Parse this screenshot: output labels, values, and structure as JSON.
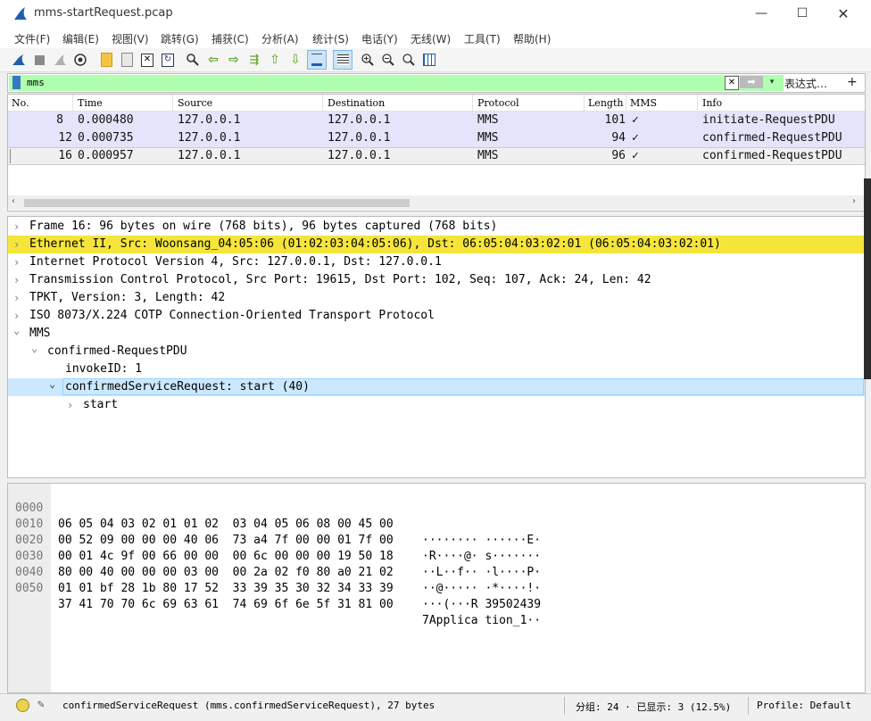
{
  "window": {
    "title": "mms-startRequest.pcap"
  },
  "menu": [
    "文件(F)",
    "编辑(E)",
    "视图(V)",
    "跳转(G)",
    "捕获(C)",
    "分析(A)",
    "统计(S)",
    "电话(Y)",
    "无线(W)",
    "工具(T)",
    "帮助(H)"
  ],
  "filter": {
    "value": "mms",
    "expression_label": "表达式…",
    "plus_label": "+"
  },
  "packet_list": {
    "columns": [
      "No.",
      "Time",
      "Source",
      "Destination",
      "Protocol",
      "Length",
      "MMS",
      "Info"
    ],
    "rows": [
      {
        "no": "8",
        "time": "0.000480",
        "src": "127.0.0.1",
        "dst": "127.0.0.1",
        "proto": "MMS",
        "len": "101",
        "mms": "✓",
        "info": "initiate-RequestPDU"
      },
      {
        "no": "12",
        "time": "0.000735",
        "src": "127.0.0.1",
        "dst": "127.0.0.1",
        "proto": "MMS",
        "len": "94",
        "mms": "✓",
        "info": "confirmed-RequestPDU"
      },
      {
        "no": "16",
        "time": "0.000957",
        "src": "127.0.0.1",
        "dst": "127.0.0.1",
        "proto": "MMS",
        "len": "96",
        "mms": "✓",
        "info": "confirmed-RequestPDU"
      }
    ]
  },
  "details": [
    {
      "text": "Frame 16: 96 bytes on wire (768 bits), 96 bytes captured (768 bits)",
      "arrow": "›"
    },
    {
      "text": "Ethernet II, Src: Woonsang_04:05:06 (01:02:03:04:05:06), Dst: 06:05:04:03:02:01 (06:05:04:03:02:01)",
      "arrow": "›"
    },
    {
      "text": "Internet Protocol Version 4, Src: 127.0.0.1, Dst: 127.0.0.1",
      "arrow": "›"
    },
    {
      "text": "Transmission Control Protocol, Src Port: 19615, Dst Port: 102, Seq: 107, Ack: 24, Len: 42",
      "arrow": "›"
    },
    {
      "text": "TPKT, Version: 3, Length: 42",
      "arrow": "›"
    },
    {
      "text": "ISO 8073/X.224 COTP Connection-Oriented Transport Protocol",
      "arrow": "›"
    },
    {
      "text": "MMS",
      "arrow": "⌄"
    },
    {
      "text": "confirmed-RequestPDU",
      "arrow": "⌄"
    },
    {
      "text": "invokeID: 1",
      "arrow": ""
    },
    {
      "text": "confirmedServiceRequest: start (40)",
      "arrow": "⌄"
    },
    {
      "text": "start",
      "arrow": "›"
    }
  ],
  "bytes": [
    {
      "off": "0000",
      "hex": "06 05 04 03 02 01 01 02  03 04 05 06 08 00 45 00",
      "asc": "········ ······E·"
    },
    {
      "off": "0010",
      "hex": "00 52 09 00 00 00 40 06  73 a4 7f 00 00 01 7f 00",
      "asc": "·R····@· s·······"
    },
    {
      "off": "0020",
      "hex": "00 01 4c 9f 00 66 00 00  00 6c 00 00 00 19 50 18",
      "asc": "··L··f·· ·l····P·"
    },
    {
      "off": "0030",
      "hex": "80 00 40 00 00 00 03 00  00 2a 02 f0 80 a0 21 02",
      "asc": "··@····· ·*····!·"
    },
    {
      "off": "0040",
      "hex": "01 01 bf 28 1b 80 17 52  33 39 35 30 32 34 33 39",
      "asc": "···(···R 39502439"
    },
    {
      "off": "0050",
      "hex": "37 41 70 70 6c 69 63 61  74 69 6f 6e 5f 31 81 00",
      "asc": "7Applica tion_1··"
    }
  ],
  "status": {
    "field": "confirmedServiceRequest (mms.confirmedServiceRequest), 27 bytes",
    "packets": "分组: 24 · 已显示: 3 (12.5%)",
    "profile": "Profile: Default"
  },
  "colors": {
    "row_bg": "#e4e4fa",
    "selected_row": "#f0f0f0",
    "highlight_yellow": "#f5e53a",
    "selected_detail": "#cce8ff",
    "filter_green": "#afffaf"
  }
}
